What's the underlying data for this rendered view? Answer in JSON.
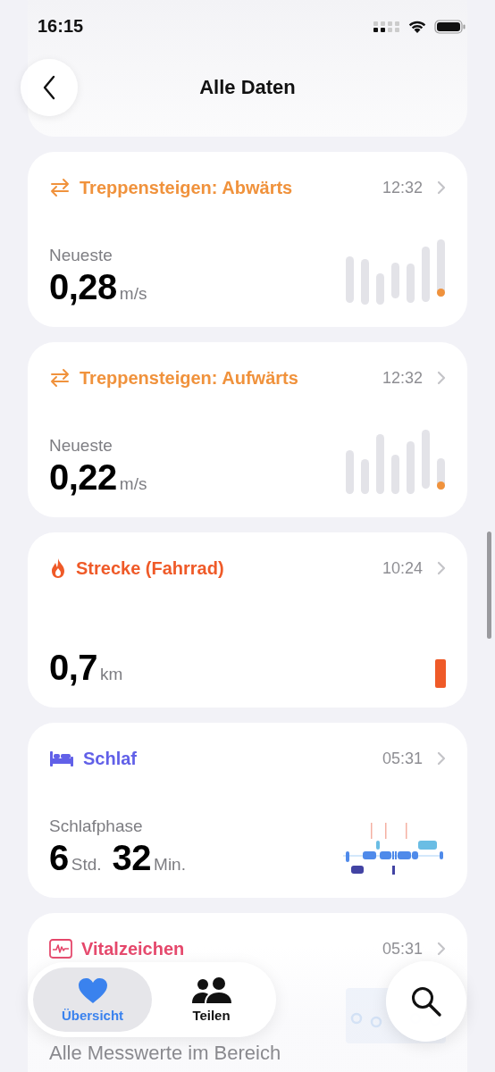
{
  "status_bar": {
    "time": "16:15"
  },
  "nav": {
    "title": "Alle Daten"
  },
  "cards": [
    {
      "kind": "stairs-down",
      "title": "Treppensteigen: Abwärts",
      "color": "#f0923c",
      "time": "12:32",
      "label": "Neueste",
      "value": [
        {
          "number": "0,28",
          "unit": "m/s"
        }
      ]
    },
    {
      "kind": "stairs-up",
      "title": "Treppensteigen: Aufwärts",
      "color": "#f0923c",
      "time": "12:32",
      "label": "Neueste",
      "value": [
        {
          "number": "0,22",
          "unit": "m/s"
        }
      ]
    },
    {
      "kind": "cycling",
      "title": "Strecke (Fahrrad)",
      "color": "#ef5a28",
      "time": "10:24",
      "value": [
        {
          "number": "0,7",
          "unit": "km"
        }
      ]
    },
    {
      "kind": "sleep",
      "title": "Schlaf",
      "color": "#6160e8",
      "time": "05:31",
      "label": "Schlafphase",
      "value": [
        {
          "number": "6",
          "unit": "Std."
        },
        {
          "number": "32",
          "unit": "Min."
        }
      ]
    },
    {
      "kind": "vitals",
      "title": "Vitalzeichen",
      "color": "#e5466a",
      "time": "05:31",
      "label": "Alle Messwerte im Bereich"
    }
  ],
  "tab_bar": {
    "tabs": [
      {
        "label": "Übersicht",
        "selected": true
      },
      {
        "label": "Teilen",
        "selected": false
      }
    ]
  }
}
